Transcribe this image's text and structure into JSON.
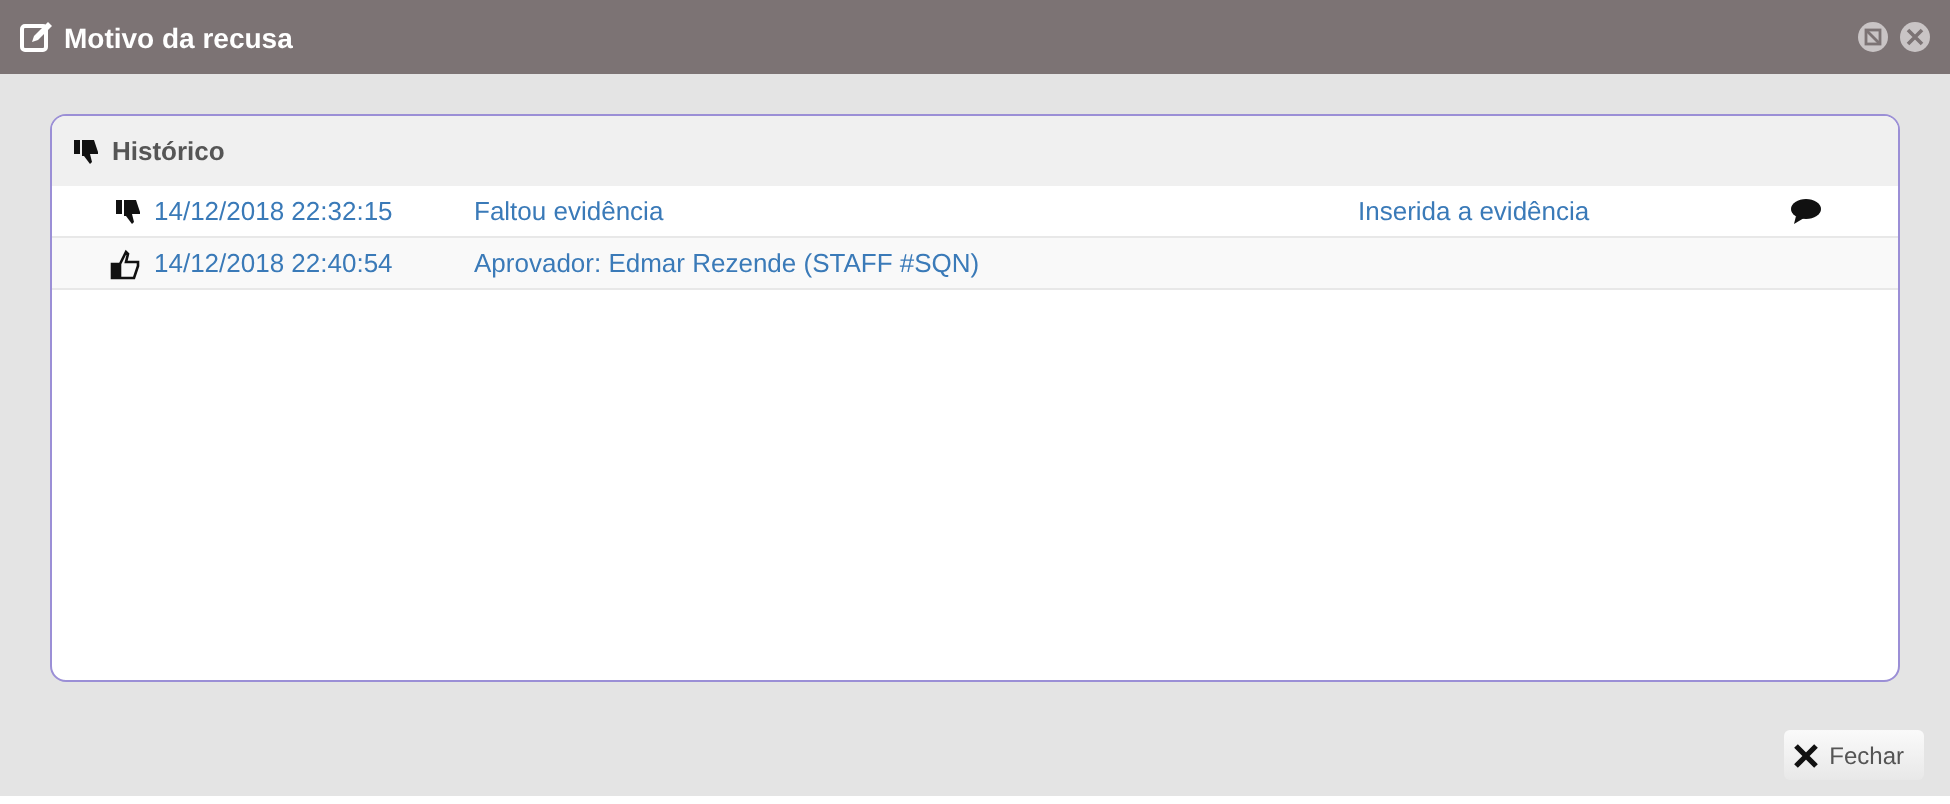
{
  "window": {
    "title": "Motivo da recusa"
  },
  "panel": {
    "title": "Histórico"
  },
  "rows": [
    {
      "kind": "rejected",
      "date": "14/12/2018 22:32:15",
      "reason": "Faltou evidência",
      "column_3": "Inserida a evidência",
      "has_comment": true
    },
    {
      "kind": "approved",
      "date": "14/12/2018 22:40:54",
      "reason": "Aprovador: Edmar Rezende (STAFF #SQN)",
      "has_comment": false
    }
  ],
  "buttons": [
    {
      "label": "Fechar"
    }
  ]
}
